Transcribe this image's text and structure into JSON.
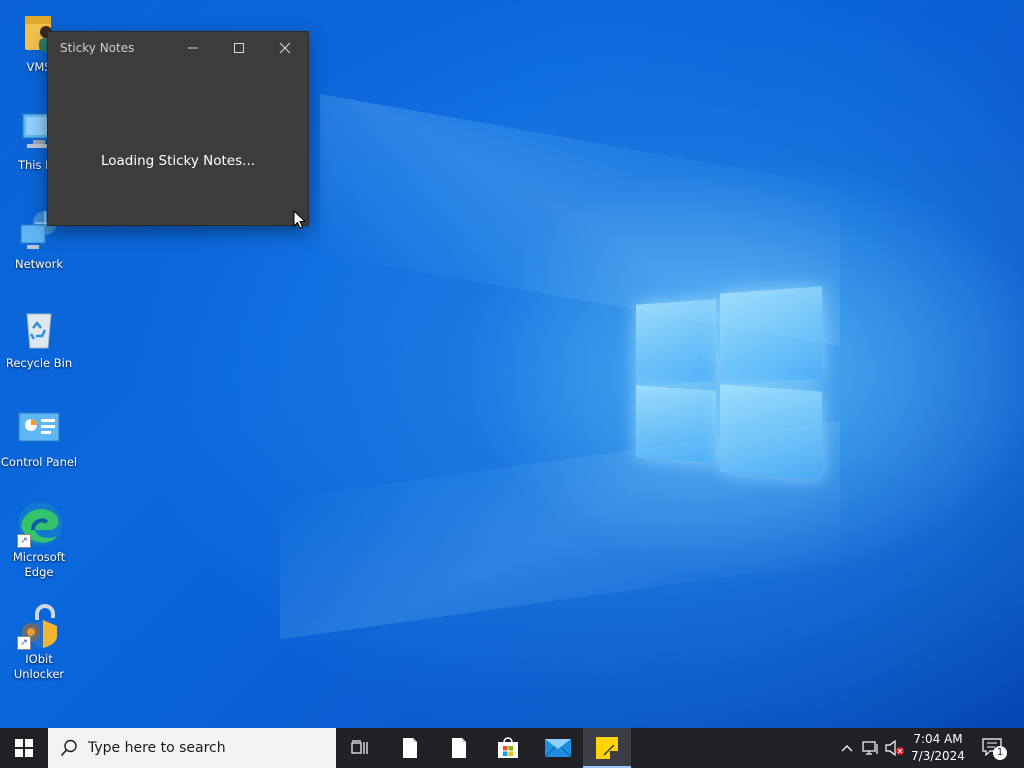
{
  "desktop": {
    "icons": [
      {
        "label": "VMS",
        "icon": "user-folder-icon"
      },
      {
        "label": "This PC",
        "icon": "computer-icon"
      },
      {
        "label": "Network",
        "icon": "network-icon"
      },
      {
        "label": "Recycle Bin",
        "icon": "recycle-bin-icon"
      },
      {
        "label": "Control Panel",
        "icon": "control-panel-icon"
      },
      {
        "label": "Microsoft\nEdge",
        "line1": "Microsoft",
        "line2": "Edge",
        "icon": "edge-icon"
      },
      {
        "label": "IObit Unlocker",
        "line1": "IObit",
        "line2": "Unlocker",
        "icon": "iobit-unlocker-icon"
      }
    ]
  },
  "sticky_window": {
    "title": "Sticky Notes",
    "loading_text": "Loading Sticky Notes...",
    "controls": {
      "minimize": "minimize-icon",
      "maximize": "maximize-icon",
      "close": "close-icon"
    }
  },
  "taskbar": {
    "search_placeholder": "Type here to search",
    "apps": [
      "task-view-icon",
      "file-icon",
      "file-icon",
      "microsoft-store-icon",
      "mail-icon",
      "sticky-notes-icon"
    ],
    "tray": {
      "time": "7:04 AM",
      "date": "7/3/2024",
      "notification_count": "1"
    }
  },
  "colors": {
    "taskbar": "#1f2127",
    "window_bg": "#3c3c3c",
    "desktop_blue": "#0b63d6",
    "sticky_yellow": "#ffd400"
  }
}
